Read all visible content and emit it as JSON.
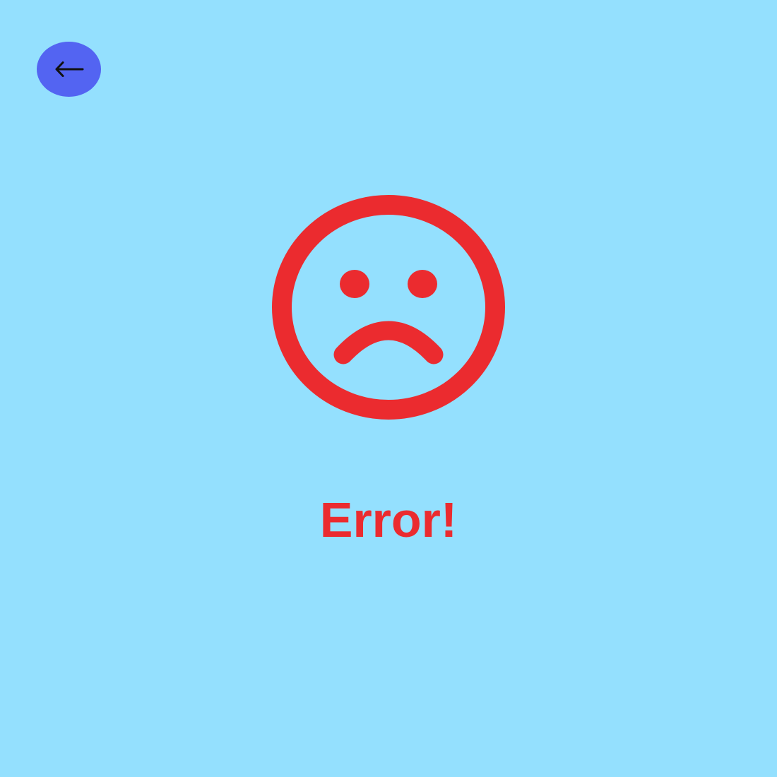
{
  "background_color": "#94E0FE",
  "back_button": {
    "icon": "arrow-left-icon",
    "color": "#5364F2"
  },
  "error_icon": {
    "icon": "sad-face-icon",
    "color": "#EB2B2F"
  },
  "message": {
    "title": "Error!",
    "color": "#EB2B2F"
  }
}
